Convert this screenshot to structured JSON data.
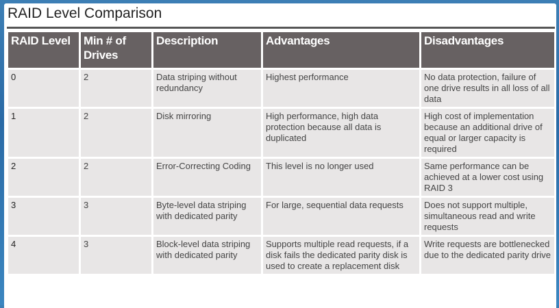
{
  "title": "RAID Level Comparison",
  "columns": [
    "RAID Level",
    "Min # of Drives",
    "Description",
    "Advantages",
    "Disadvantages"
  ],
  "rows": [
    {
      "level": "0",
      "min_drives": "2",
      "description": "Data striping without redundancy",
      "advantages": "Highest performance",
      "disadvantages": "No data protection, failure of one drive results in all loss of all data"
    },
    {
      "level": "1",
      "min_drives": "2",
      "description": "Disk mirroring",
      "advantages": "High performance, high data protection because all data is duplicated",
      "disadvantages": "High cost of implementation because an additional drive of equal or larger capacity is required"
    },
    {
      "level": "2",
      "min_drives": "2",
      "description": "Error-Correcting Coding",
      "advantages": "This level is no longer used",
      "disadvantages": "Same performance can be achieved at a lower cost using RAID 3"
    },
    {
      "level": "3",
      "min_drives": "3",
      "description": "Byte-level data striping with dedicated parity",
      "advantages": "For large, sequential data requests",
      "disadvantages": "Does not support multiple, simultaneous read and write requests"
    },
    {
      "level": "4",
      "min_drives": "3",
      "description": "Block-level data striping with dedicated parity",
      "advantages": "Supports multiple read requests, if a disk fails the dedicated parity disk is used to create a replacement disk",
      "disadvantages": "Write requests are bottlenecked due to the dedicated parity drive"
    }
  ]
}
